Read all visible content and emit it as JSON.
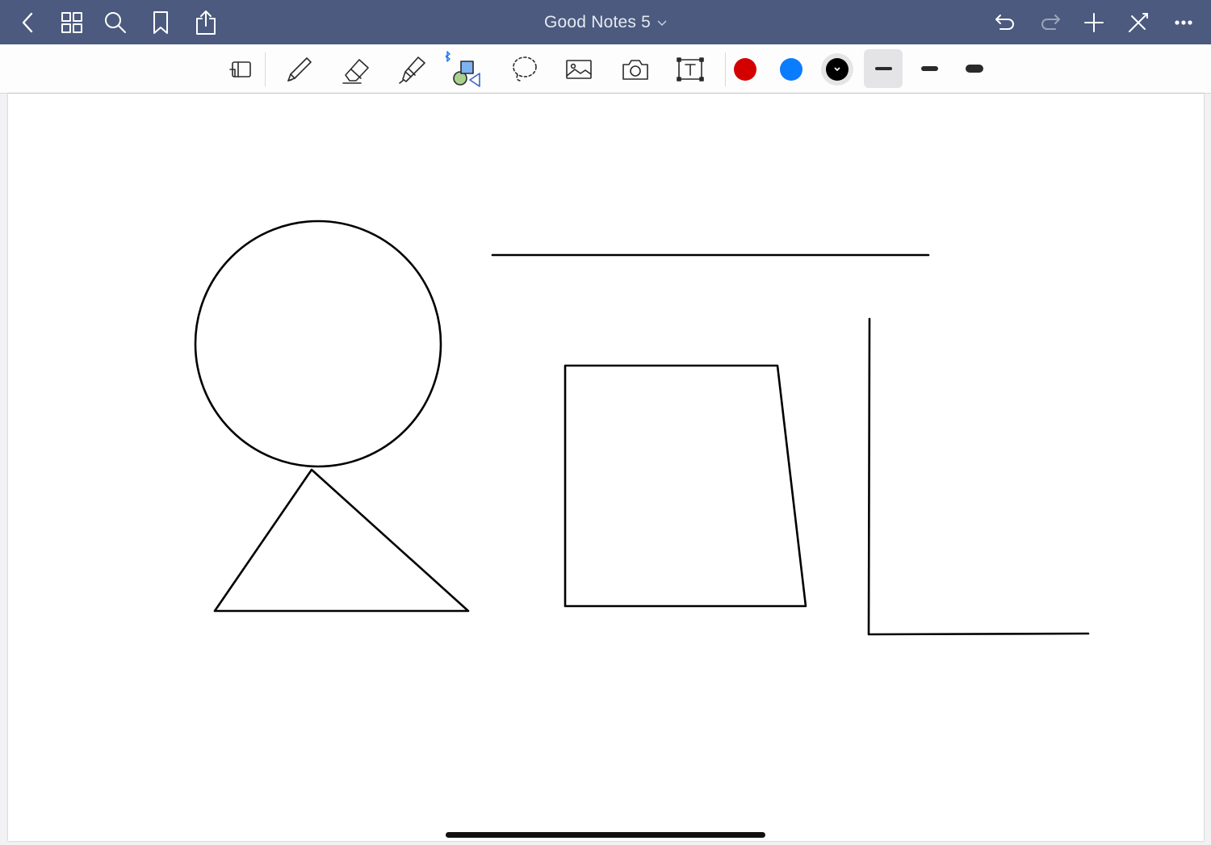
{
  "app": {
    "title": "Good Notes 5"
  },
  "colors": {
    "header_bg": "#4b5a7e",
    "swatch_red": "#d40000",
    "swatch_blue": "#0a7cff",
    "swatch_black": "#000000",
    "bluetooth": "#1a73e8"
  },
  "header": {
    "left_icons": [
      "back-icon",
      "grid-icon",
      "search-icon",
      "bookmark-icon",
      "share-icon"
    ],
    "right_icons": [
      "undo-icon",
      "redo-icon",
      "add-page-icon",
      "close-tools-icon",
      "more-icon"
    ]
  },
  "toolbar": {
    "tools": [
      "zoom-window-tool",
      "pen-tool",
      "eraser-tool",
      "highlighter-tool",
      "shape-tool",
      "lasso-tool",
      "image-tool",
      "camera-tool",
      "text-tool"
    ],
    "colors": [
      "red",
      "blue",
      "black"
    ],
    "selected_color": "black",
    "stroke_sizes": [
      "thin",
      "medium",
      "thick"
    ],
    "selected_stroke": "thin"
  },
  "canvas": {
    "shapes": [
      "circle",
      "triangle",
      "horizontal-line",
      "quadrilateral",
      "right-angle"
    ]
  }
}
